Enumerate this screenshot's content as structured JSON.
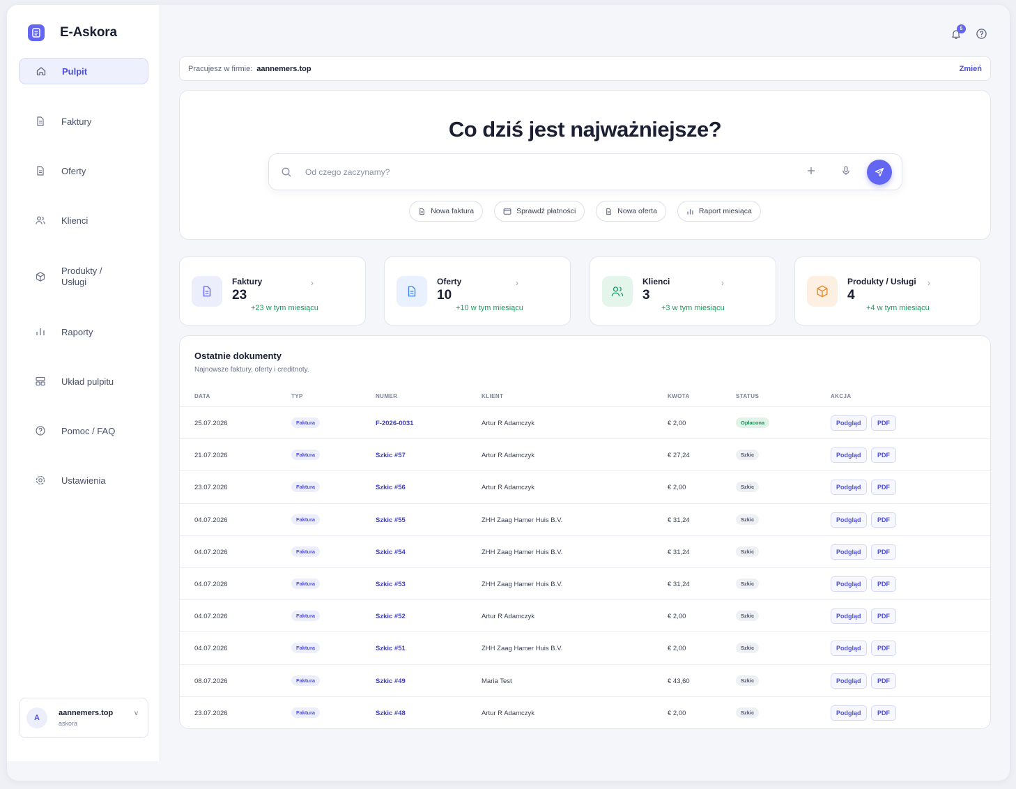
{
  "brand": {
    "name": "E-Askora"
  },
  "sidebar": {
    "items": [
      {
        "label": "Pulpit"
      },
      {
        "label": "Faktury"
      },
      {
        "label": "Oferty"
      },
      {
        "label": "Klienci"
      },
      {
        "label": "Produkty / Usługi"
      },
      {
        "label": "Raporty"
      },
      {
        "label": "Układ pulpitu"
      },
      {
        "label": "Pomoc / FAQ"
      },
      {
        "label": "Ustawienia"
      }
    ],
    "user": {
      "initial": "A",
      "name": "aannemers.top",
      "sub": "askora",
      "chevron": "v"
    }
  },
  "topbar": {
    "notifications_count": "5",
    "icons": [
      "bell-icon",
      "help-icon"
    ]
  },
  "company": {
    "label": "Pracujesz w firmie:",
    "name": "aannemers.top",
    "change_label": "Zmień"
  },
  "hero": {
    "title": "Co dziś jest najważniejsze?",
    "search_placeholder": "Od czego zaczynamy?",
    "chips": [
      {
        "label": "Nowa faktura",
        "icon": "document-icon"
      },
      {
        "label": "Sprawdź płatności",
        "icon": "card-icon"
      },
      {
        "label": "Nowa oferta",
        "icon": "document-icon"
      },
      {
        "label": "Raport miesiąca",
        "icon": "bar-chart-icon"
      }
    ]
  },
  "stats": [
    {
      "label": "Faktury",
      "value": "23",
      "delta": "+23 w tym miesiącu",
      "color": "#6366f1",
      "bg": "#eceefb"
    },
    {
      "label": "Oferty",
      "value": "10",
      "delta": "+10 w tym miesiącu",
      "color": "#3b82f6",
      "bg": "#e8f1fd"
    },
    {
      "label": "Klienci",
      "value": "3",
      "delta": "+3 w tym miesiącu",
      "color": "#22a06b",
      "bg": "#e4f5ec"
    },
    {
      "label": "Produkty / Usługi",
      "value": "4",
      "delta": "+4 w tym miesiącu",
      "color": "#e38a2b",
      "bg": "#fdf0e2"
    }
  ],
  "docs": {
    "title": "Ostatnie dokumenty",
    "subtitle": "Najnowsze faktury, oferty i creditnoty.",
    "columns": [
      "DATA",
      "TYP",
      "NUMER",
      "KLIENT",
      "KWOTA",
      "STATUS",
      "AKCJA"
    ],
    "preview_label": "Podgląd",
    "pdf_label": "PDF",
    "rows": [
      {
        "date": "25.07.2026",
        "type": "Faktura",
        "number": "F-2026-0031",
        "client": "Artur R Adamczyk",
        "amount": "€ 2,00",
        "status": "Opłacona",
        "status_kind": "paid"
      },
      {
        "date": "21.07.2026",
        "type": "Faktura",
        "number": "Szkic #57",
        "client": "Artur R Adamczyk",
        "amount": "€ 27,24",
        "status": "Szkic",
        "status_kind": "draft"
      },
      {
        "date": "23.07.2026",
        "type": "Faktura",
        "number": "Szkic #56",
        "client": "Artur R Adamczyk",
        "amount": "€ 2,00",
        "status": "Szkic",
        "status_kind": "draft"
      },
      {
        "date": "04.07.2026",
        "type": "Faktura",
        "number": "Szkic #55",
        "client": "ZHH Zaag Hamer Huis B.V.",
        "amount": "€ 31,24",
        "status": "Szkic",
        "status_kind": "draft"
      },
      {
        "date": "04.07.2026",
        "type": "Faktura",
        "number": "Szkic #54",
        "client": "ZHH Zaag Hamer Huis B.V.",
        "amount": "€ 31,24",
        "status": "Szkic",
        "status_kind": "draft"
      },
      {
        "date": "04.07.2026",
        "type": "Faktura",
        "number": "Szkic #53",
        "client": "ZHH Zaag Hamer Huis B.V.",
        "amount": "€ 31,24",
        "status": "Szkic",
        "status_kind": "draft"
      },
      {
        "date": "04.07.2026",
        "type": "Faktura",
        "number": "Szkic #52",
        "client": "Artur R Adamczyk",
        "amount": "€ 2,00",
        "status": "Szkic",
        "status_kind": "draft"
      },
      {
        "date": "04.07.2026",
        "type": "Faktura",
        "number": "Szkic #51",
        "client": "ZHH Zaag Hamer Huis B.V.",
        "amount": "€ 2,00",
        "status": "Szkic",
        "status_kind": "draft"
      },
      {
        "date": "08.07.2026",
        "type": "Faktura",
        "number": "Szkic #49",
        "client": "Maria Test",
        "amount": "€ 43,60",
        "status": "Szkic",
        "status_kind": "draft"
      },
      {
        "date": "23.07.2026",
        "type": "Faktura",
        "number": "Szkic #48",
        "client": "Artur R Adamczyk",
        "amount": "€ 2,00",
        "status": "Szkic",
        "status_kind": "draft"
      }
    ]
  },
  "colors": {
    "accent": "#6366f1",
    "paid": "#1f8a55"
  }
}
